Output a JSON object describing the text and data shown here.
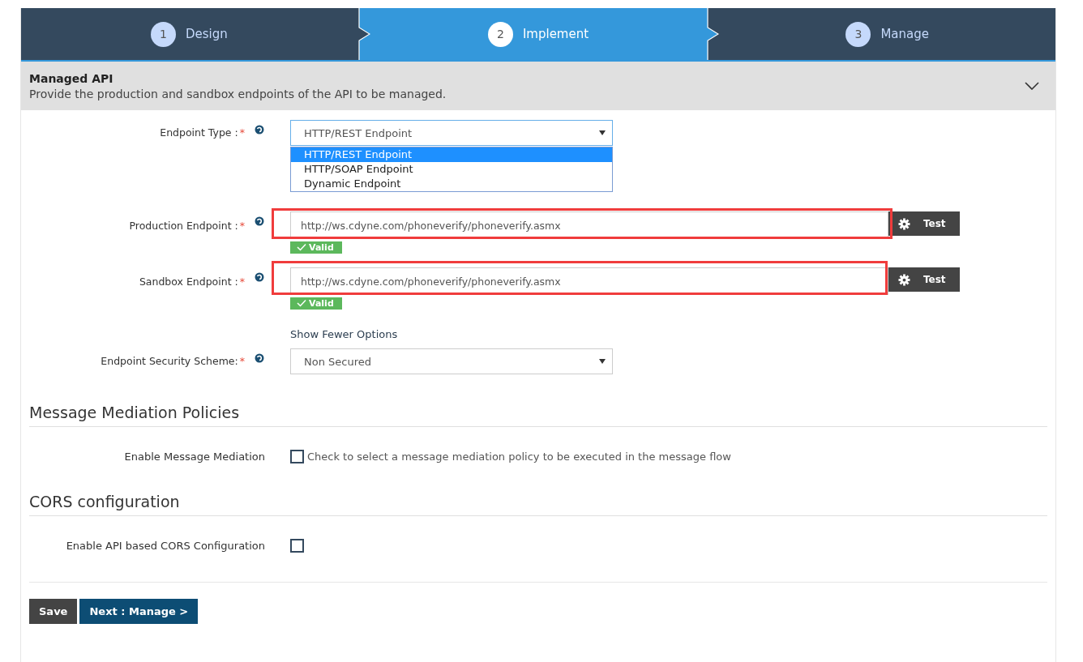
{
  "wizard": {
    "steps": [
      {
        "number": "1",
        "label": "Design",
        "selected": false
      },
      {
        "number": "2",
        "label": "Implement",
        "selected": true
      },
      {
        "number": "3",
        "label": "Manage",
        "selected": false
      }
    ]
  },
  "panel": {
    "title": "Managed API",
    "description": "Provide the production and sandbox endpoints of the API to be managed.",
    "expanded": true
  },
  "endpoint_type": {
    "label": "Endpoint Type :",
    "required_mark": "*",
    "value": "HTTP/REST Endpoint",
    "options": [
      {
        "label": "HTTP/REST Endpoint",
        "selected": true
      },
      {
        "label": "HTTP/SOAP Endpoint",
        "selected": false
      },
      {
        "label": "Dynamic Endpoint",
        "selected": false
      }
    ]
  },
  "endpoints": [
    {
      "label": "Production Endpoint :",
      "required_mark": "*",
      "value": "http://ws.cdyne.com/phoneverify/phoneverify.asmx",
      "button": "Test",
      "status": "Valid",
      "highlighted": true
    },
    {
      "label": "Sandbox Endpoint :",
      "required_mark": "*",
      "value": "http://ws.cdyne.com/phoneverify/phoneverify.asmx",
      "button": "Test",
      "status": "Valid",
      "highlighted": true
    }
  ],
  "show_options_link": "Show Fewer Options",
  "security": {
    "label": "Endpoint Security Scheme:",
    "required_mark": "*",
    "value": "Non Secured"
  },
  "sections": [
    {
      "title": "Message Mediation Policies",
      "label": "Enable Message Mediation",
      "checked": false,
      "hint": "Check to select a message mediation policy to be executed in the message flow"
    },
    {
      "title": "CORS configuration",
      "label": "Enable API based CORS Configuration",
      "checked": false
    }
  ],
  "buttons": {
    "save": "Save",
    "next": "Next : Manage >"
  }
}
